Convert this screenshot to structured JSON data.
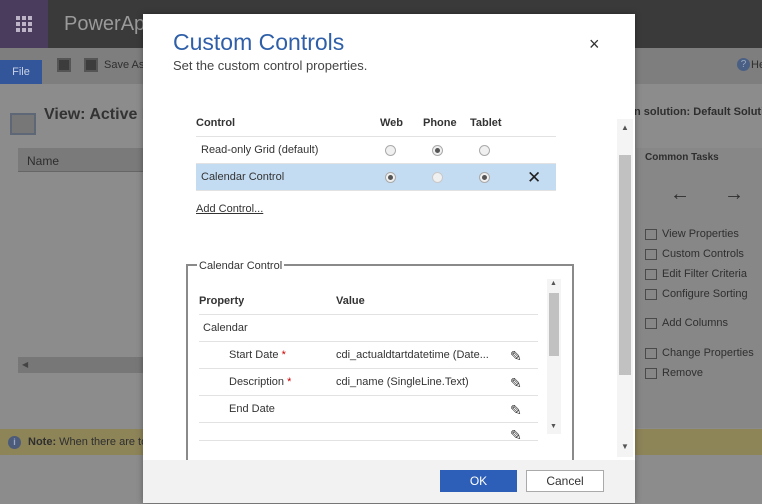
{
  "app": {
    "title": "PowerAp",
    "file_tab": "File",
    "save_as": "Save As",
    "help": "He",
    "view_title": "View: Active E",
    "grid_column": "Name",
    "solution_label": "n solution: Default Soluti",
    "common_tasks": "Common Tasks",
    "task_back": "←",
    "task_forward": "→",
    "tasks": [
      {
        "label": "View Properties",
        "icon": "view-properties-icon"
      },
      {
        "label": "Custom Controls",
        "icon": "custom-controls-icon"
      },
      {
        "label": "Edit Filter Criteria",
        "icon": "filter-icon"
      },
      {
        "label": "Configure Sorting",
        "icon": "sorting-icon"
      },
      {
        "label": "Add Columns",
        "icon": "add-columns-icon"
      },
      {
        "label": "Change Properties",
        "icon": "change-properties-icon"
      },
      {
        "label": "Remove",
        "icon": "remove-icon"
      }
    ],
    "note_label": "Note:",
    "note_text": "When there are to"
  },
  "dialog": {
    "title": "Custom Controls",
    "subtitle": "Set the custom control properties.",
    "close": "×",
    "controls_table": {
      "headers": [
        "Control",
        "Web",
        "Phone",
        "Tablet"
      ],
      "rows": [
        {
          "name": "Read-only Grid (default)",
          "web": false,
          "phone": true,
          "tablet": false,
          "selected": false
        },
        {
          "name": "Calendar Control",
          "web": true,
          "phone": false,
          "tablet": true,
          "selected": true,
          "remove": "✕"
        }
      ]
    },
    "add_control": "Add Control...",
    "group_title": "Calendar Control",
    "properties_table": {
      "headers": [
        "Property",
        "Value"
      ],
      "section": "Calendar",
      "rows": [
        {
          "property": "Start Date",
          "required": "*",
          "value": "cdi_actualdtartdatetime (Date..."
        },
        {
          "property": "Description",
          "required": "*",
          "value": "cdi_name (SingleLine.Text)"
        },
        {
          "property": "End Date",
          "required": "",
          "value": ""
        }
      ]
    },
    "ok": "OK",
    "cancel": "Cancel"
  }
}
